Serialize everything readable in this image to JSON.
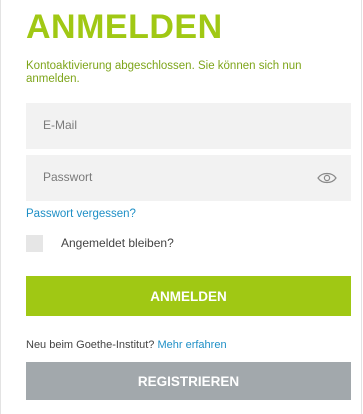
{
  "page": {
    "title": "ANMELDEN",
    "status_message": "Kontoaktivierung abgeschlossen. Sie können sich nun anmelden."
  },
  "form": {
    "email_placeholder": "E-Mail",
    "password_placeholder": "Passwort",
    "show_password_icon": "eye-icon",
    "forgot_password": "Passwort vergessen?",
    "remember_me": "Angemeldet bleiben?",
    "remember_checked": false,
    "login_button": "ANMELDEN"
  },
  "register": {
    "prompt": "Neu beim Goethe-Institut?",
    "more_link": "Mehr erfahren",
    "button": "REGISTRIEREN"
  },
  "colors": {
    "accent": "#a0c814",
    "link": "#1e8fc6",
    "secondary_button": "#a2a8ac",
    "field_bg": "#f2f2f2"
  }
}
